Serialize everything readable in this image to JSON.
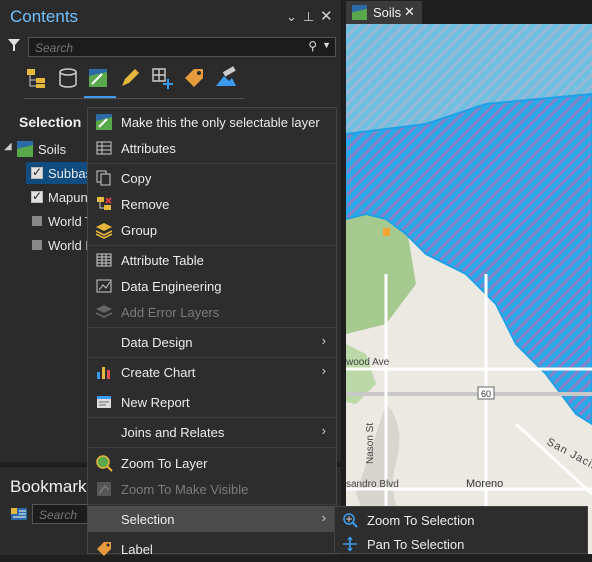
{
  "contents": {
    "title": "Contents",
    "search_placeholder": "Search",
    "selection_heading": "Selection",
    "layers": [
      {
        "label": "Soils"
      },
      {
        "label": "Subbas"
      },
      {
        "label": "Mapuni"
      },
      {
        "label": "World T"
      },
      {
        "label": "World H"
      }
    ]
  },
  "bookmarks": {
    "title": "Bookmarks",
    "search_placeholder": "Search"
  },
  "map": {
    "tab_label": "Soils",
    "labels": {
      "street1": "wood Ave",
      "street2": "Nason St",
      "street3": "sandro Blvd",
      "city": "Moreno",
      "route": "60",
      "place": "San Jacin"
    }
  },
  "context_menu": {
    "items": [
      {
        "label": "Make this the only selectable layer"
      },
      {
        "label": "Attributes"
      },
      {
        "label": "Copy"
      },
      {
        "label": "Remove"
      },
      {
        "label": "Group"
      },
      {
        "label": "Attribute Table"
      },
      {
        "label": "Data Engineering"
      },
      {
        "label": "Add Error Layers"
      },
      {
        "label": "Data Design"
      },
      {
        "label": "Create Chart"
      },
      {
        "label": "New Report"
      },
      {
        "label": "Joins and Relates"
      },
      {
        "label": "Zoom To Layer"
      },
      {
        "label": "Zoom To Make Visible"
      },
      {
        "label": "Selection"
      },
      {
        "label": "Label"
      }
    ]
  },
  "submenu": {
    "items": [
      {
        "label": "Zoom To Selection"
      },
      {
        "label": "Pan To Selection"
      }
    ]
  },
  "colors": {
    "accent": "#3b9bf0",
    "title_blue": "#6ec1ff",
    "selected_row": "#0f4d80",
    "menu_bg": "#2d2d2d",
    "water_blue": "#2aa9e8",
    "hatch_purple": "#8a7fc8"
  }
}
